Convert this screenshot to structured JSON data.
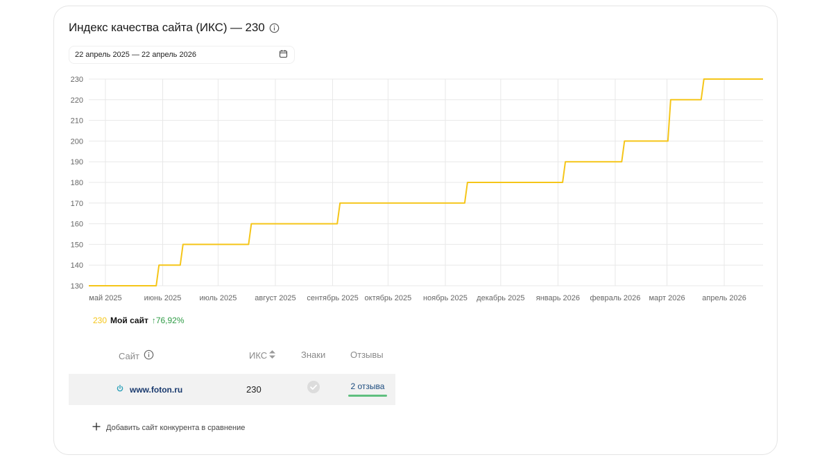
{
  "header": {
    "title": "Индекс качества сайта (ИКС) — 230",
    "date_range": "22 апрель 2025 — 22 апрель 2026"
  },
  "colors": {
    "line": "#f5c518",
    "grid": "#e8e8e8",
    "axis_text": "#666666",
    "delta_positive": "#2e9b45"
  },
  "chart_data": {
    "type": "line",
    "title": "",
    "xlabel": "",
    "ylabel": "",
    "ylim": [
      130,
      230
    ],
    "yticks": [
      130,
      140,
      150,
      160,
      170,
      180,
      190,
      200,
      210,
      220,
      230
    ],
    "xlim": [
      "2025-04-22",
      "2026-04-22"
    ],
    "xticks": [
      {
        "date": "2025-05-01",
        "label": "май 2025"
      },
      {
        "date": "2025-06-01",
        "label": "июнь 2025"
      },
      {
        "date": "2025-07-01",
        "label": "июль 2025"
      },
      {
        "date": "2025-08-01",
        "label": "август 2025"
      },
      {
        "date": "2025-09-01",
        "label": "сентябрь 2025"
      },
      {
        "date": "2025-10-01",
        "label": "октябрь 2025"
      },
      {
        "date": "2025-11-01",
        "label": "ноябрь 2025"
      },
      {
        "date": "2025-12-01",
        "label": "декабрь 2025"
      },
      {
        "date": "2026-01-01",
        "label": "январь 2026"
      },
      {
        "date": "2026-02-01",
        "label": "февраль 2026"
      },
      {
        "date": "2026-03-01",
        "label": "март 2026"
      },
      {
        "date": "2026-04-01",
        "label": "апрель 2026"
      }
    ],
    "grid": true,
    "legend": "bottom-left",
    "series": [
      {
        "name": "Мой сайт",
        "step": true,
        "points": [
          {
            "x": "2025-04-22",
            "y": 130
          },
          {
            "x": "2025-05-30",
            "y": 140
          },
          {
            "x": "2025-06-12",
            "y": 150
          },
          {
            "x": "2025-07-19",
            "y": 160
          },
          {
            "x": "2025-09-05",
            "y": 170
          },
          {
            "x": "2025-11-13",
            "y": 180
          },
          {
            "x": "2026-01-05",
            "y": 190
          },
          {
            "x": "2026-02-06",
            "y": 200
          },
          {
            "x": "2026-03-03",
            "y": 220
          },
          {
            "x": "2026-03-21",
            "y": 230
          },
          {
            "x": "2026-04-22",
            "y": 230
          }
        ]
      }
    ]
  },
  "legend": {
    "value": "230",
    "name": "Мой сайт",
    "delta": "↑76,92%"
  },
  "table": {
    "headers": {
      "site": "Сайт",
      "iks": "ИКС",
      "signs": "Знаки",
      "reviews": "Отзывы"
    },
    "rows": [
      {
        "site": "www.foton.ru",
        "iks": "230",
        "reviews": "2 отзыва"
      }
    ]
  },
  "actions": {
    "add_competitor": "Добавить сайт конкурента в сравнение"
  }
}
